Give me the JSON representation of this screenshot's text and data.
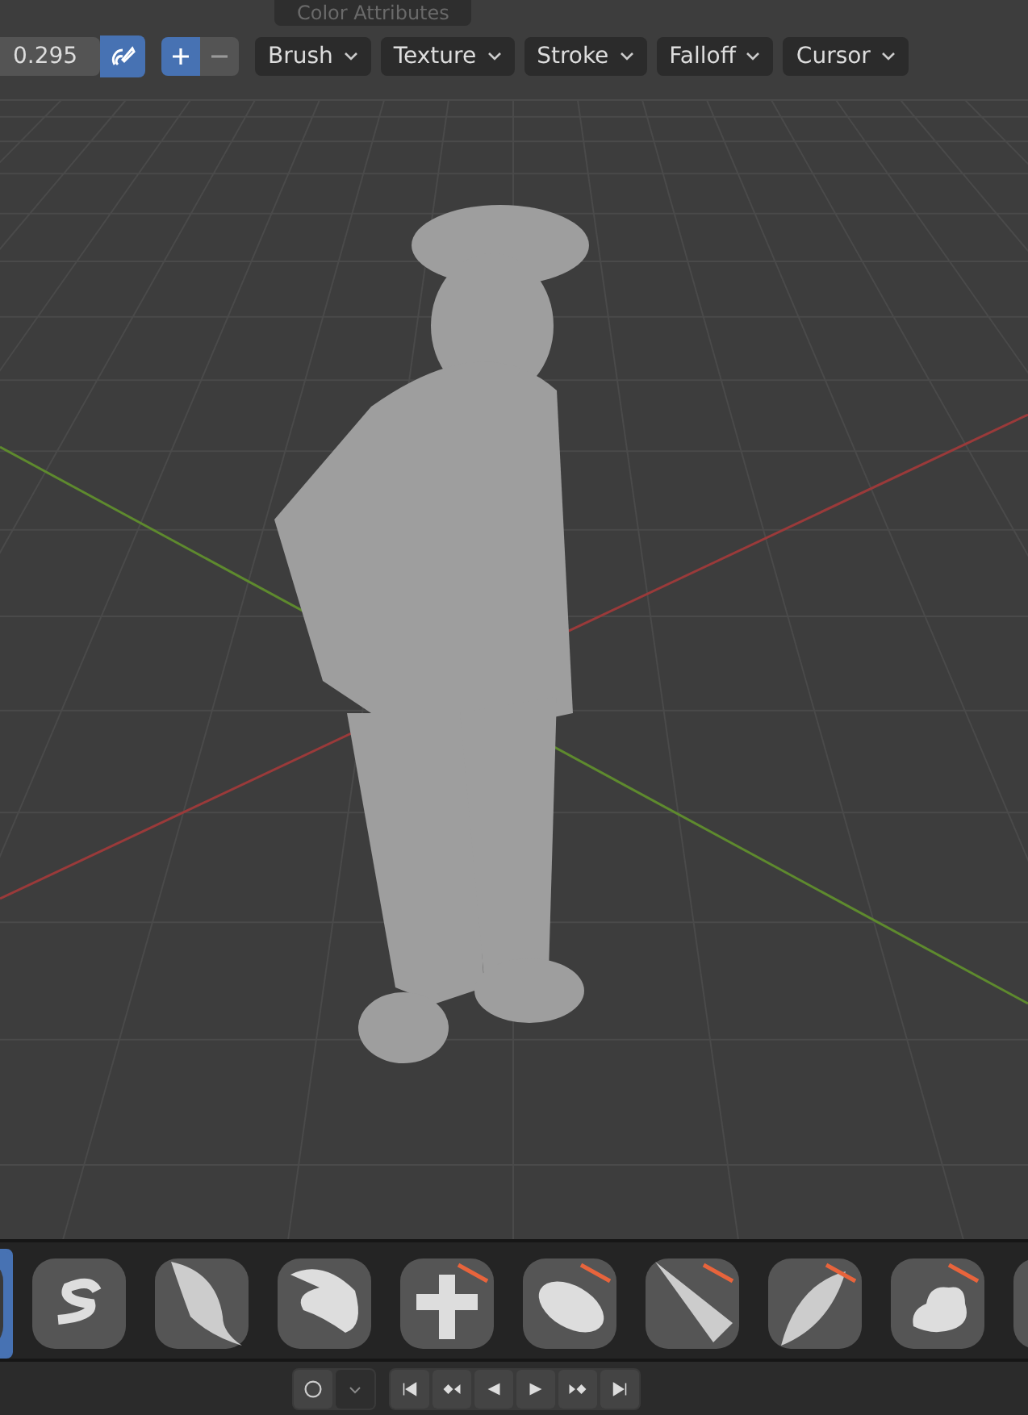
{
  "header": {
    "attribute_dropdown": "Color Attributes"
  },
  "toolbar": {
    "strength": "0.295",
    "pressure_on": true,
    "modes": [
      {
        "kind": "add",
        "selected": true
      },
      {
        "kind": "subtract",
        "selected": false
      }
    ],
    "menus": [
      "Brush",
      "Texture",
      "Stroke",
      "Falloff",
      "Cursor"
    ]
  },
  "brushes": [
    {
      "kind": "blank",
      "selected": true
    },
    {
      "kind": "stroke",
      "selected": false
    },
    {
      "kind": "blob",
      "selected": false
    },
    {
      "kind": "shape",
      "selected": false
    },
    {
      "kind": "cross",
      "selected": false
    },
    {
      "kind": "disc",
      "selected": false
    },
    {
      "kind": "cone",
      "selected": false
    },
    {
      "kind": "blade",
      "selected": false
    },
    {
      "kind": "bumpy",
      "selected": false
    },
    {
      "kind": "rough",
      "selected": false
    }
  ],
  "playback": {
    "buttons": [
      {
        "kind": "first"
      },
      {
        "kind": "prev-key"
      },
      {
        "kind": "reverse"
      },
      {
        "kind": "play"
      },
      {
        "kind": "next-key"
      },
      {
        "kind": "last"
      }
    ]
  }
}
